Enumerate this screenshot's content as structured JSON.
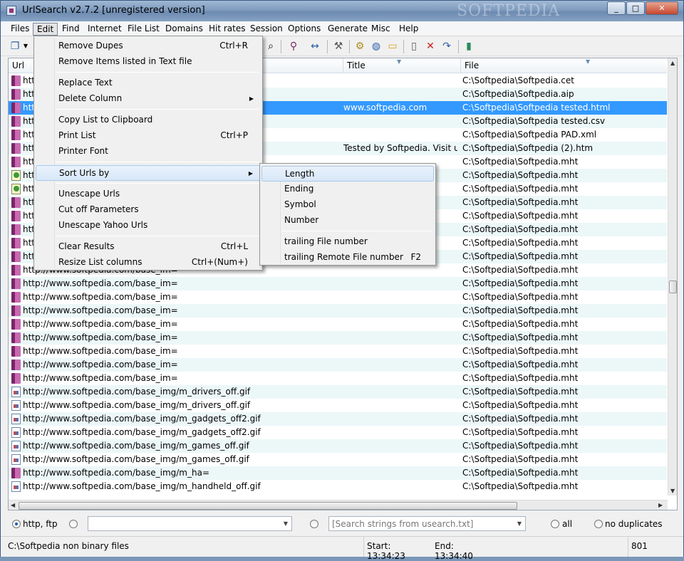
{
  "window": {
    "title": "UrlSearch v2.7.2 [unregistered version]",
    "watermark": "SOFTPEDIA",
    "controls": {
      "minimize": "_",
      "maximize": "□",
      "close": "✕"
    }
  },
  "menubar": [
    "Files",
    "Edit",
    "Find",
    "Internet",
    "File List",
    "Domains",
    "Hit rates",
    "Session",
    "Options",
    "Generate",
    "Misc",
    "Help"
  ],
  "toolbar": {
    "icons": [
      "copy-icon",
      "dropdown-arrow-icon",
      "binoculars-icon",
      "filter-icon",
      "resize-columns-icon",
      "hammer-icon",
      "search-globe-icon",
      "globe-icon",
      "folder-icon",
      "new-page-icon",
      "delete-icon",
      "undo-icon",
      "exit-door-icon"
    ]
  },
  "columns": {
    "url": "Url",
    "title": "Title",
    "file": "File"
  },
  "rows": [
    {
      "icon": "book",
      "url": "htt",
      "title": "",
      "file": "C:\\Softpedia\\Softpedia.cet"
    },
    {
      "icon": "book",
      "url": "htt",
      "title": "",
      "file": "C:\\Softpedia\\Softpedia.aip"
    },
    {
      "icon": "book",
      "url": "htt",
      "title": "www.softpedia.com",
      "file": "C:\\Softpedia\\Softpedia tested.html"
    },
    {
      "icon": "book",
      "url": "htt",
      "title": "",
      "file": "C:\\Softpedia\\Softpedia tested.csv"
    },
    {
      "icon": "book",
      "url": "htt",
      "title": "",
      "file": "C:\\Softpedia\\Softpedia PAD.xml"
    },
    {
      "icon": "book",
      "url": "htt",
      "title": "Tested by Softpedia. Visit us ...",
      "file": "C:\\Softpedia\\Softpedia (2).htm"
    },
    {
      "icon": "book",
      "url": "htt",
      "title": "",
      "file": "C:\\Softpedia\\Softpedia.mht"
    },
    {
      "icon": "img",
      "url": "htt",
      "title": "",
      "file": "C:\\Softpedia\\Softpedia.mht"
    },
    {
      "icon": "img",
      "url": "htt",
      "title": "",
      "file": "C:\\Softpedia\\Softpedia.mht"
    },
    {
      "icon": "book",
      "url": "htt",
      "title": "",
      "file": "C:\\Softpedia\\Softpedia.mht"
    },
    {
      "icon": "book",
      "url": "htt",
      "title": "",
      "file": "C:\\Softpedia\\Softpedia.mht"
    },
    {
      "icon": "book",
      "url": "htt",
      "title": "",
      "file": "C:\\Softpedia\\Softpedia.mht"
    },
    {
      "icon": "book",
      "url": "htt",
      "title": "",
      "file": "C:\\Softpedia\\Softpedia.mht"
    },
    {
      "icon": "book",
      "url": "htt",
      "title": "",
      "file": "C:\\Softpedia\\Softpedia.mht"
    },
    {
      "icon": "book",
      "url": "http://www.softpedia.com/base_im=",
      "title": "",
      "file": "C:\\Softpedia\\Softpedia.mht"
    },
    {
      "icon": "book",
      "url": "http://www.softpedia.com/base_im=",
      "title": "",
      "file": "C:\\Softpedia\\Softpedia.mht"
    },
    {
      "icon": "book",
      "url": "http://www.softpedia.com/base_im=",
      "title": "",
      "file": "C:\\Softpedia\\Softpedia.mht"
    },
    {
      "icon": "book",
      "url": "http://www.softpedia.com/base_im=",
      "title": "",
      "file": "C:\\Softpedia\\Softpedia.mht"
    },
    {
      "icon": "book",
      "url": "http://www.softpedia.com/base_im=",
      "title": "",
      "file": "C:\\Softpedia\\Softpedia.mht"
    },
    {
      "icon": "book",
      "url": "http://www.softpedia.com/base_im=",
      "title": "",
      "file": "C:\\Softpedia\\Softpedia.mht"
    },
    {
      "icon": "book",
      "url": "http://www.softpedia.com/base_im=",
      "title": "",
      "file": "C:\\Softpedia\\Softpedia.mht"
    },
    {
      "icon": "book",
      "url": "http://www.softpedia.com/base_im=",
      "title": "",
      "file": "C:\\Softpedia\\Softpedia.mht"
    },
    {
      "icon": "book",
      "url": "http://www.softpedia.com/base_im=",
      "title": "",
      "file": "C:\\Softpedia\\Softpedia.mht"
    },
    {
      "icon": "page",
      "url": "http://www.softpedia.com/base_img/m_drivers_off.gif",
      "title": "",
      "file": "C:\\Softpedia\\Softpedia.mht"
    },
    {
      "icon": "page",
      "url": "http://www.softpedia.com/base_img/m_drivers_off.gif",
      "title": "",
      "file": "C:\\Softpedia\\Softpedia.mht"
    },
    {
      "icon": "page",
      "url": "http://www.softpedia.com/base_img/m_gadgets_off2.gif",
      "title": "",
      "file": "C:\\Softpedia\\Softpedia.mht"
    },
    {
      "icon": "page",
      "url": "http://www.softpedia.com/base_img/m_gadgets_off2.gif",
      "title": "",
      "file": "C:\\Softpedia\\Softpedia.mht"
    },
    {
      "icon": "page",
      "url": "http://www.softpedia.com/base_img/m_games_off.gif",
      "title": "",
      "file": "C:\\Softpedia\\Softpedia.mht"
    },
    {
      "icon": "page",
      "url": "http://www.softpedia.com/base_img/m_games_off.gif",
      "title": "",
      "file": "C:\\Softpedia\\Softpedia.mht"
    },
    {
      "icon": "book",
      "url": "http://www.softpedia.com/base_img/m_ha=",
      "title": "",
      "file": "C:\\Softpedia\\Softpedia.mht"
    },
    {
      "icon": "page",
      "url": "http://www.softpedia.com/base_img/m_handheld_off.gif",
      "title": "",
      "file": "C:\\Softpedia\\Softpedia.mht"
    }
  ],
  "selected_row": 2,
  "edit_menu": [
    {
      "label": "Remove Dupes",
      "shortcut": "Ctrl+R"
    },
    {
      "label": "Remove Items listed in Text file",
      "shortcut": ""
    },
    {
      "sep": true
    },
    {
      "label": "Replace Text",
      "shortcut": ""
    },
    {
      "label": "Delete Column",
      "shortcut": "",
      "submenu": true
    },
    {
      "sep": true
    },
    {
      "label": "Copy List to Clipboard",
      "shortcut": ""
    },
    {
      "label": "Print List",
      "shortcut": "Ctrl+P"
    },
    {
      "label": "Printer Font",
      "shortcut": ""
    },
    {
      "sep": true
    },
    {
      "label": "Sort Urls by",
      "shortcut": "",
      "submenu": true,
      "highlight": true
    },
    {
      "sep": true
    },
    {
      "label": "Unescape Urls",
      "shortcut": ""
    },
    {
      "label": "Cut off Parameters",
      "shortcut": ""
    },
    {
      "label": "Unescape Yahoo Urls",
      "shortcut": ""
    },
    {
      "sep": true
    },
    {
      "label": "Clear Results",
      "shortcut": "Ctrl+L"
    },
    {
      "label": "Resize List columns",
      "shortcut": "Ctrl+(Num+)"
    }
  ],
  "sort_submenu": [
    {
      "label": "Length",
      "shortcut": "",
      "highlight": true
    },
    {
      "label": "Ending",
      "shortcut": ""
    },
    {
      "label": "Symbol",
      "shortcut": ""
    },
    {
      "label": "Number",
      "shortcut": ""
    },
    {
      "sep": true
    },
    {
      "label": "trailing File number",
      "shortcut": ""
    },
    {
      "label": "trailing Remote File number",
      "shortcut": "F2"
    }
  ],
  "filter": {
    "opt_http": "http, ftp",
    "combo1_value": "",
    "combo2_placeholder": "[Search strings from usearch.txt]",
    "opt_all": "all",
    "opt_nodup": "no duplicates"
  },
  "status": {
    "path": "C:\\Softpedia non binary files",
    "start": "Start: 13:34:23",
    "end": "End: 13:34:40",
    "count": "801"
  }
}
